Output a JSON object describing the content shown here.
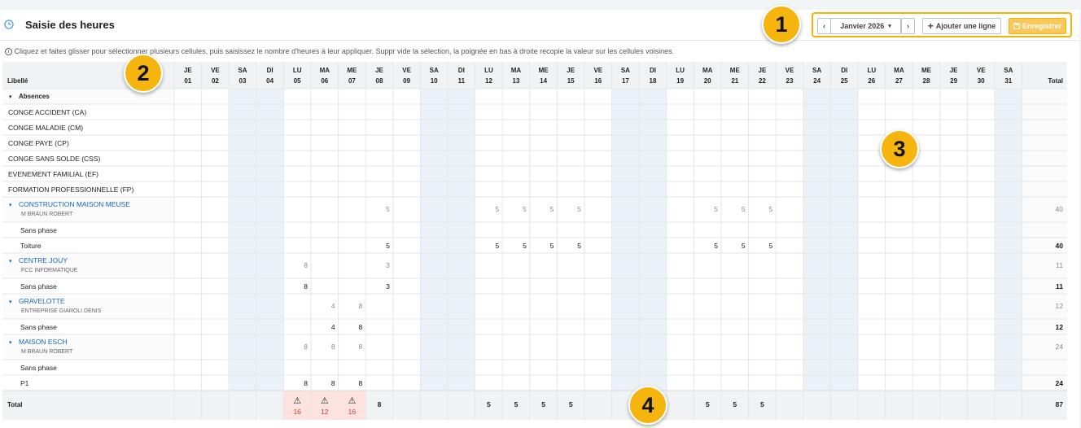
{
  "header": {
    "title": "Saisie des heures"
  },
  "toolbar": {
    "prev": "‹",
    "month": "Janvier 2026",
    "month_caret": "▾",
    "next": "›",
    "add_line": "Ajouter une ligne",
    "save": "Enregistrer"
  },
  "info_text": "Cliquez et faites glisser pour sélectionner plusieurs cellules, puis saisissez le nombre d'heures à leur appliquer. Suppr vide la sélection, la poignée en bas à droite recopie la valeur sur les cellules voisines.",
  "badges": [
    "1",
    "2",
    "3",
    "4"
  ],
  "colors": {
    "weekend": "#eaf1f7",
    "link": "#1565c0",
    "warning_bg": "#fde2e0",
    "warning_text": "#d9382c",
    "accent": "#f5b301"
  },
  "table": {
    "label_header": "Libellé",
    "total_header": "Total",
    "days": [
      {
        "d": "JE",
        "n": "01"
      },
      {
        "d": "VE",
        "n": "02"
      },
      {
        "d": "SA",
        "n": "03",
        "weekend": true
      },
      {
        "d": "DI",
        "n": "04",
        "weekend": true
      },
      {
        "d": "LU",
        "n": "05"
      },
      {
        "d": "MA",
        "n": "06"
      },
      {
        "d": "ME",
        "n": "07"
      },
      {
        "d": "JE",
        "n": "08"
      },
      {
        "d": "VE",
        "n": "09"
      },
      {
        "d": "SA",
        "n": "10",
        "weekend": true
      },
      {
        "d": "DI",
        "n": "11",
        "weekend": true
      },
      {
        "d": "LU",
        "n": "12"
      },
      {
        "d": "MA",
        "n": "13"
      },
      {
        "d": "ME",
        "n": "14"
      },
      {
        "d": "JE",
        "n": "15"
      },
      {
        "d": "VE",
        "n": "16"
      },
      {
        "d": "SA",
        "n": "17",
        "weekend": true
      },
      {
        "d": "DI",
        "n": "18",
        "weekend": true
      },
      {
        "d": "LU",
        "n": "19"
      },
      {
        "d": "MA",
        "n": "20"
      },
      {
        "d": "ME",
        "n": "21"
      },
      {
        "d": "JE",
        "n": "22"
      },
      {
        "d": "VE",
        "n": "23"
      },
      {
        "d": "SA",
        "n": "24",
        "weekend": true
      },
      {
        "d": "DI",
        "n": "25",
        "weekend": true
      },
      {
        "d": "LU",
        "n": "26"
      },
      {
        "d": "MA",
        "n": "27"
      },
      {
        "d": "ME",
        "n": "28"
      },
      {
        "d": "JE",
        "n": "29"
      },
      {
        "d": "VE",
        "n": "30"
      },
      {
        "d": "SA",
        "n": "31",
        "weekend": true
      }
    ],
    "rows": [
      {
        "type": "group",
        "label": "Absences",
        "caret": "▾"
      },
      {
        "type": "item",
        "label": "CONGE ACCIDENT (CA)",
        "values": {},
        "total": ""
      },
      {
        "type": "item",
        "label": "CONGE MALADIE (CM)",
        "values": {},
        "total": ""
      },
      {
        "type": "item",
        "label": "CONGE PAYE (CP)",
        "values": {},
        "total": ""
      },
      {
        "type": "item",
        "label": "CONGE SANS SOLDE (CSS)",
        "values": {},
        "total": ""
      },
      {
        "type": "item",
        "label": "EVENEMENT FAMILIAL (EF)",
        "values": {},
        "total": ""
      },
      {
        "type": "item",
        "label": "FORMATION PROFESSIONNELLE (FP)",
        "values": {},
        "total": ""
      },
      {
        "type": "project",
        "label": "CONSTRUCTION MAISON MEUSE",
        "sub": "M BRAUN ROBERT",
        "caret": "▾",
        "values": {
          "08": "5",
          "12": "5",
          "13": "5",
          "14": "5",
          "15": "5",
          "20": "5",
          "21": "5",
          "22": "5"
        },
        "total": "40"
      },
      {
        "type": "phase",
        "label": "Sans phase",
        "values": {},
        "total": ""
      },
      {
        "type": "phase",
        "label": "Toiture",
        "values": {
          "08": "5",
          "12": "5",
          "13": "5",
          "14": "5",
          "15": "5",
          "20": "5",
          "21": "5",
          "22": "5"
        },
        "total": "40"
      },
      {
        "type": "project",
        "label": "CENTRE JOUY",
        "sub": "FCC INFORMATIQUE",
        "caret": "▾",
        "values": {
          "05": "8",
          "08": "3"
        },
        "total": "11"
      },
      {
        "type": "phase",
        "label": "Sans phase",
        "values": {
          "05": "8",
          "08": "3"
        },
        "total": "11"
      },
      {
        "type": "project",
        "label": "GRAVELOTTE",
        "sub": "ENTREPRISE GIAROLI DENIS",
        "caret": "▾",
        "values": {
          "06": "4",
          "07": "8"
        },
        "total": "12"
      },
      {
        "type": "phase",
        "label": "Sans phase",
        "values": {
          "06": "4",
          "07": "8"
        },
        "total": "12"
      },
      {
        "type": "project",
        "label": "MAISON ESCH",
        "sub": "M BRAUN ROBERT",
        "caret": "▾",
        "values": {
          "05": "8",
          "06": "8",
          "07": "8"
        },
        "total": "24"
      },
      {
        "type": "phase",
        "label": "Sans phase",
        "values": {},
        "total": ""
      },
      {
        "type": "phase",
        "label": "P1",
        "values": {
          "05": "8",
          "06": "8",
          "07": "8"
        },
        "total": "24"
      }
    ],
    "total_row": {
      "label": "Total",
      "values": {
        "08": "8",
        "12": "5",
        "13": "5",
        "14": "5",
        "15": "5",
        "20": "5",
        "21": "5",
        "22": "5"
      },
      "warnings": {
        "05": "16",
        "06": "12",
        "07": "16"
      },
      "warning_icon": "⚠",
      "total": "87"
    }
  }
}
